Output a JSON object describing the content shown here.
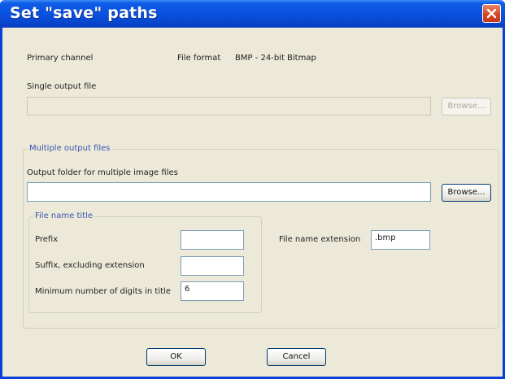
{
  "window": {
    "title": "Set \"save\" paths",
    "close_icon": "close-icon"
  },
  "primary": {
    "channel_label": "Primary channel",
    "file_format_label": "File format",
    "file_format_value": "BMP - 24-bit Bitmap"
  },
  "single_output": {
    "label": "Single output file",
    "value": "",
    "browse_label": "Browse..."
  },
  "multiple_output": {
    "group_title": "Multiple output files",
    "folder_label": "Output folder for multiple image files",
    "folder_value": "",
    "browse_label": "Browse...",
    "file_name_title": {
      "group_title": "File name title",
      "prefix_label": "Prefix",
      "prefix_value": "",
      "suffix_label": "Suffix, excluding extension",
      "suffix_value": "",
      "min_digits_label": "Minimum number of digits in title",
      "min_digits_value": "6"
    },
    "extension_label": "File name extension",
    "extension_value": ".bmp"
  },
  "buttons": {
    "ok_label": "OK",
    "cancel_label": "Cancel"
  },
  "colors": {
    "titlebar": "#0a52df",
    "dialog_bg": "#ece9d8",
    "group_title": "#3a55b4",
    "close_button": "#d2441c"
  }
}
